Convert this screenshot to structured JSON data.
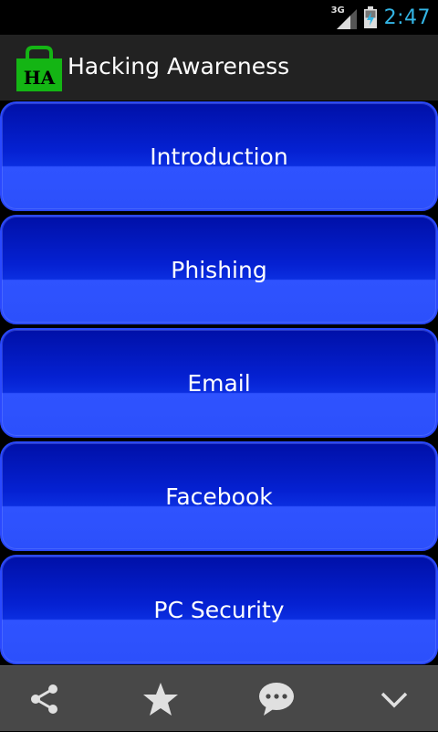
{
  "status_bar": {
    "network_type": "3G",
    "time": "2:47",
    "time_color": "#33b5e5"
  },
  "action_bar": {
    "logo_text": "HA",
    "logo_color": "#14b514",
    "title": "Hacking Awareness"
  },
  "menu": {
    "items": [
      {
        "label": "Introduction"
      },
      {
        "label": "Phishing"
      },
      {
        "label": "Email"
      },
      {
        "label": "Facebook"
      },
      {
        "label": "PC Security"
      }
    ],
    "button_color": "#0521d2"
  },
  "bottom_bar": {
    "icons": [
      "share-icon",
      "star-icon",
      "chat-bubble-icon",
      "chevron-down-icon"
    ]
  }
}
